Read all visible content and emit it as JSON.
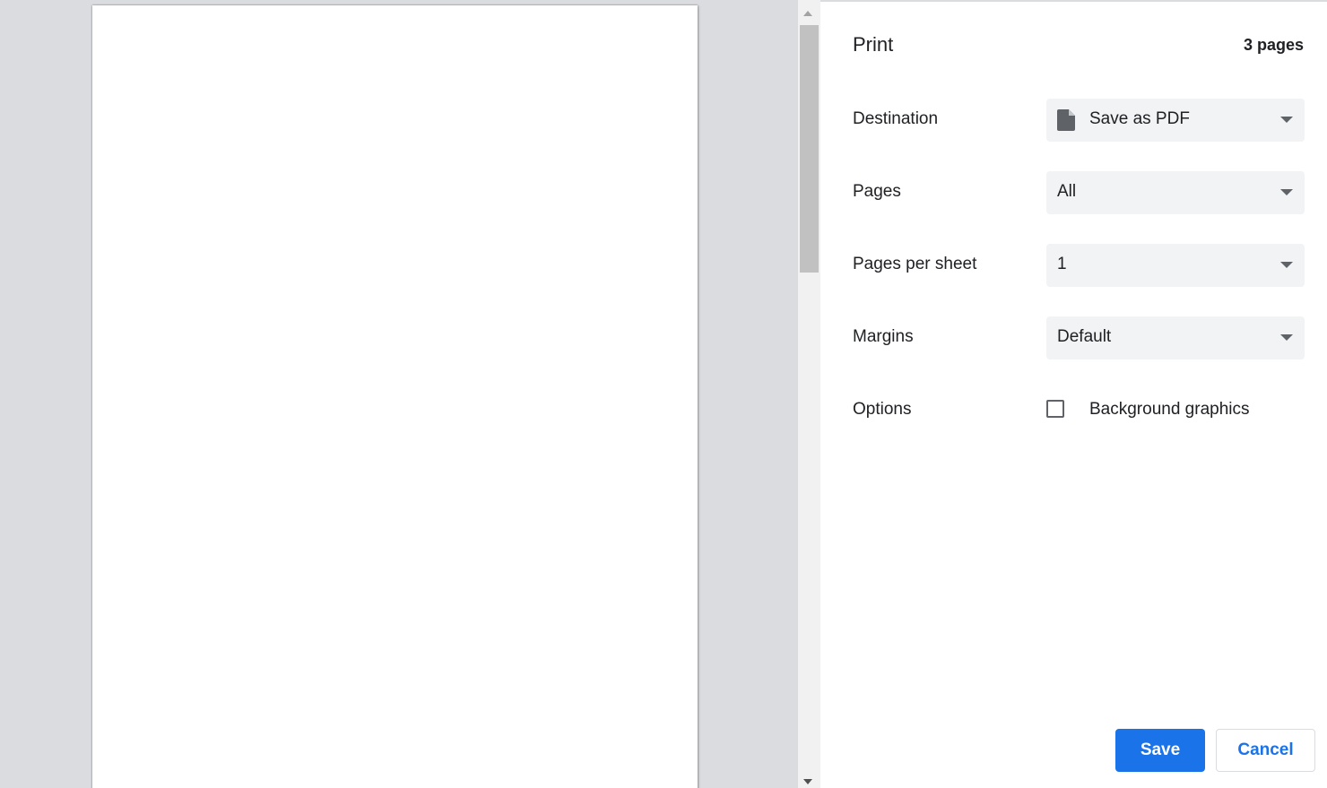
{
  "header": {
    "title": "Print",
    "page_count": "3 pages"
  },
  "settings": {
    "destination": {
      "label": "Destination",
      "value": "Save as PDF",
      "icon": "document-icon"
    },
    "pages": {
      "label": "Pages",
      "value": "All"
    },
    "pages_per_sheet": {
      "label": "Pages per sheet",
      "value": "1"
    },
    "margins": {
      "label": "Margins",
      "value": "Default"
    },
    "options": {
      "label": "Options",
      "background_graphics": {
        "label": "Background graphics",
        "checked": false
      }
    }
  },
  "buttons": {
    "save": "Save",
    "cancel": "Cancel"
  },
  "colors": {
    "accent": "#1a73e8",
    "preview_bg": "#dadce0",
    "select_bg": "#f1f3f4"
  }
}
